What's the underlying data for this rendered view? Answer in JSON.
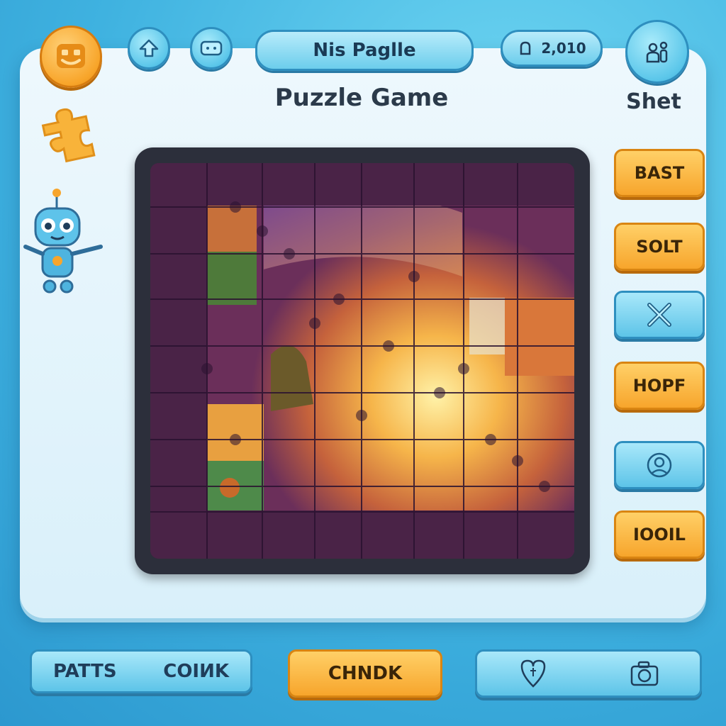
{
  "header": {
    "level_name": "Nis Paglle",
    "coins": "2,010",
    "title": "Puzzle Game",
    "side_label": "Shet"
  },
  "icons": {
    "logo": "smiley-face-icon",
    "home": "home-arrow-icon",
    "controller": "gamepad-icon",
    "coin": "coin-icon",
    "profile": "profile-icon",
    "puzzle_piece": "puzzle-piece-icon",
    "mascot": "robot-mascot-icon"
  },
  "side_buttons": [
    {
      "label": "BAST",
      "style": "orange"
    },
    {
      "label": "SOLT",
      "style": "orange"
    },
    {
      "label": "",
      "style": "blue",
      "icon": "close-x-icon"
    },
    {
      "label": "HOPF",
      "style": "orange"
    },
    {
      "label": "",
      "style": "blue",
      "icon": "user-circle-icon"
    },
    {
      "label": "IOOIL",
      "style": "orange"
    }
  ],
  "bottom": {
    "left_label_1": "PATTS",
    "left_label_2": "COIИK",
    "center_label": "CHNDK",
    "right_icons": [
      "heart-gem-icon",
      "camera-icon"
    ]
  },
  "colors": {
    "accent_orange": "#f7a52c",
    "accent_blue": "#5dc4e8",
    "board_purple": "#4a2347",
    "frame_dark": "#2c2f3b"
  }
}
